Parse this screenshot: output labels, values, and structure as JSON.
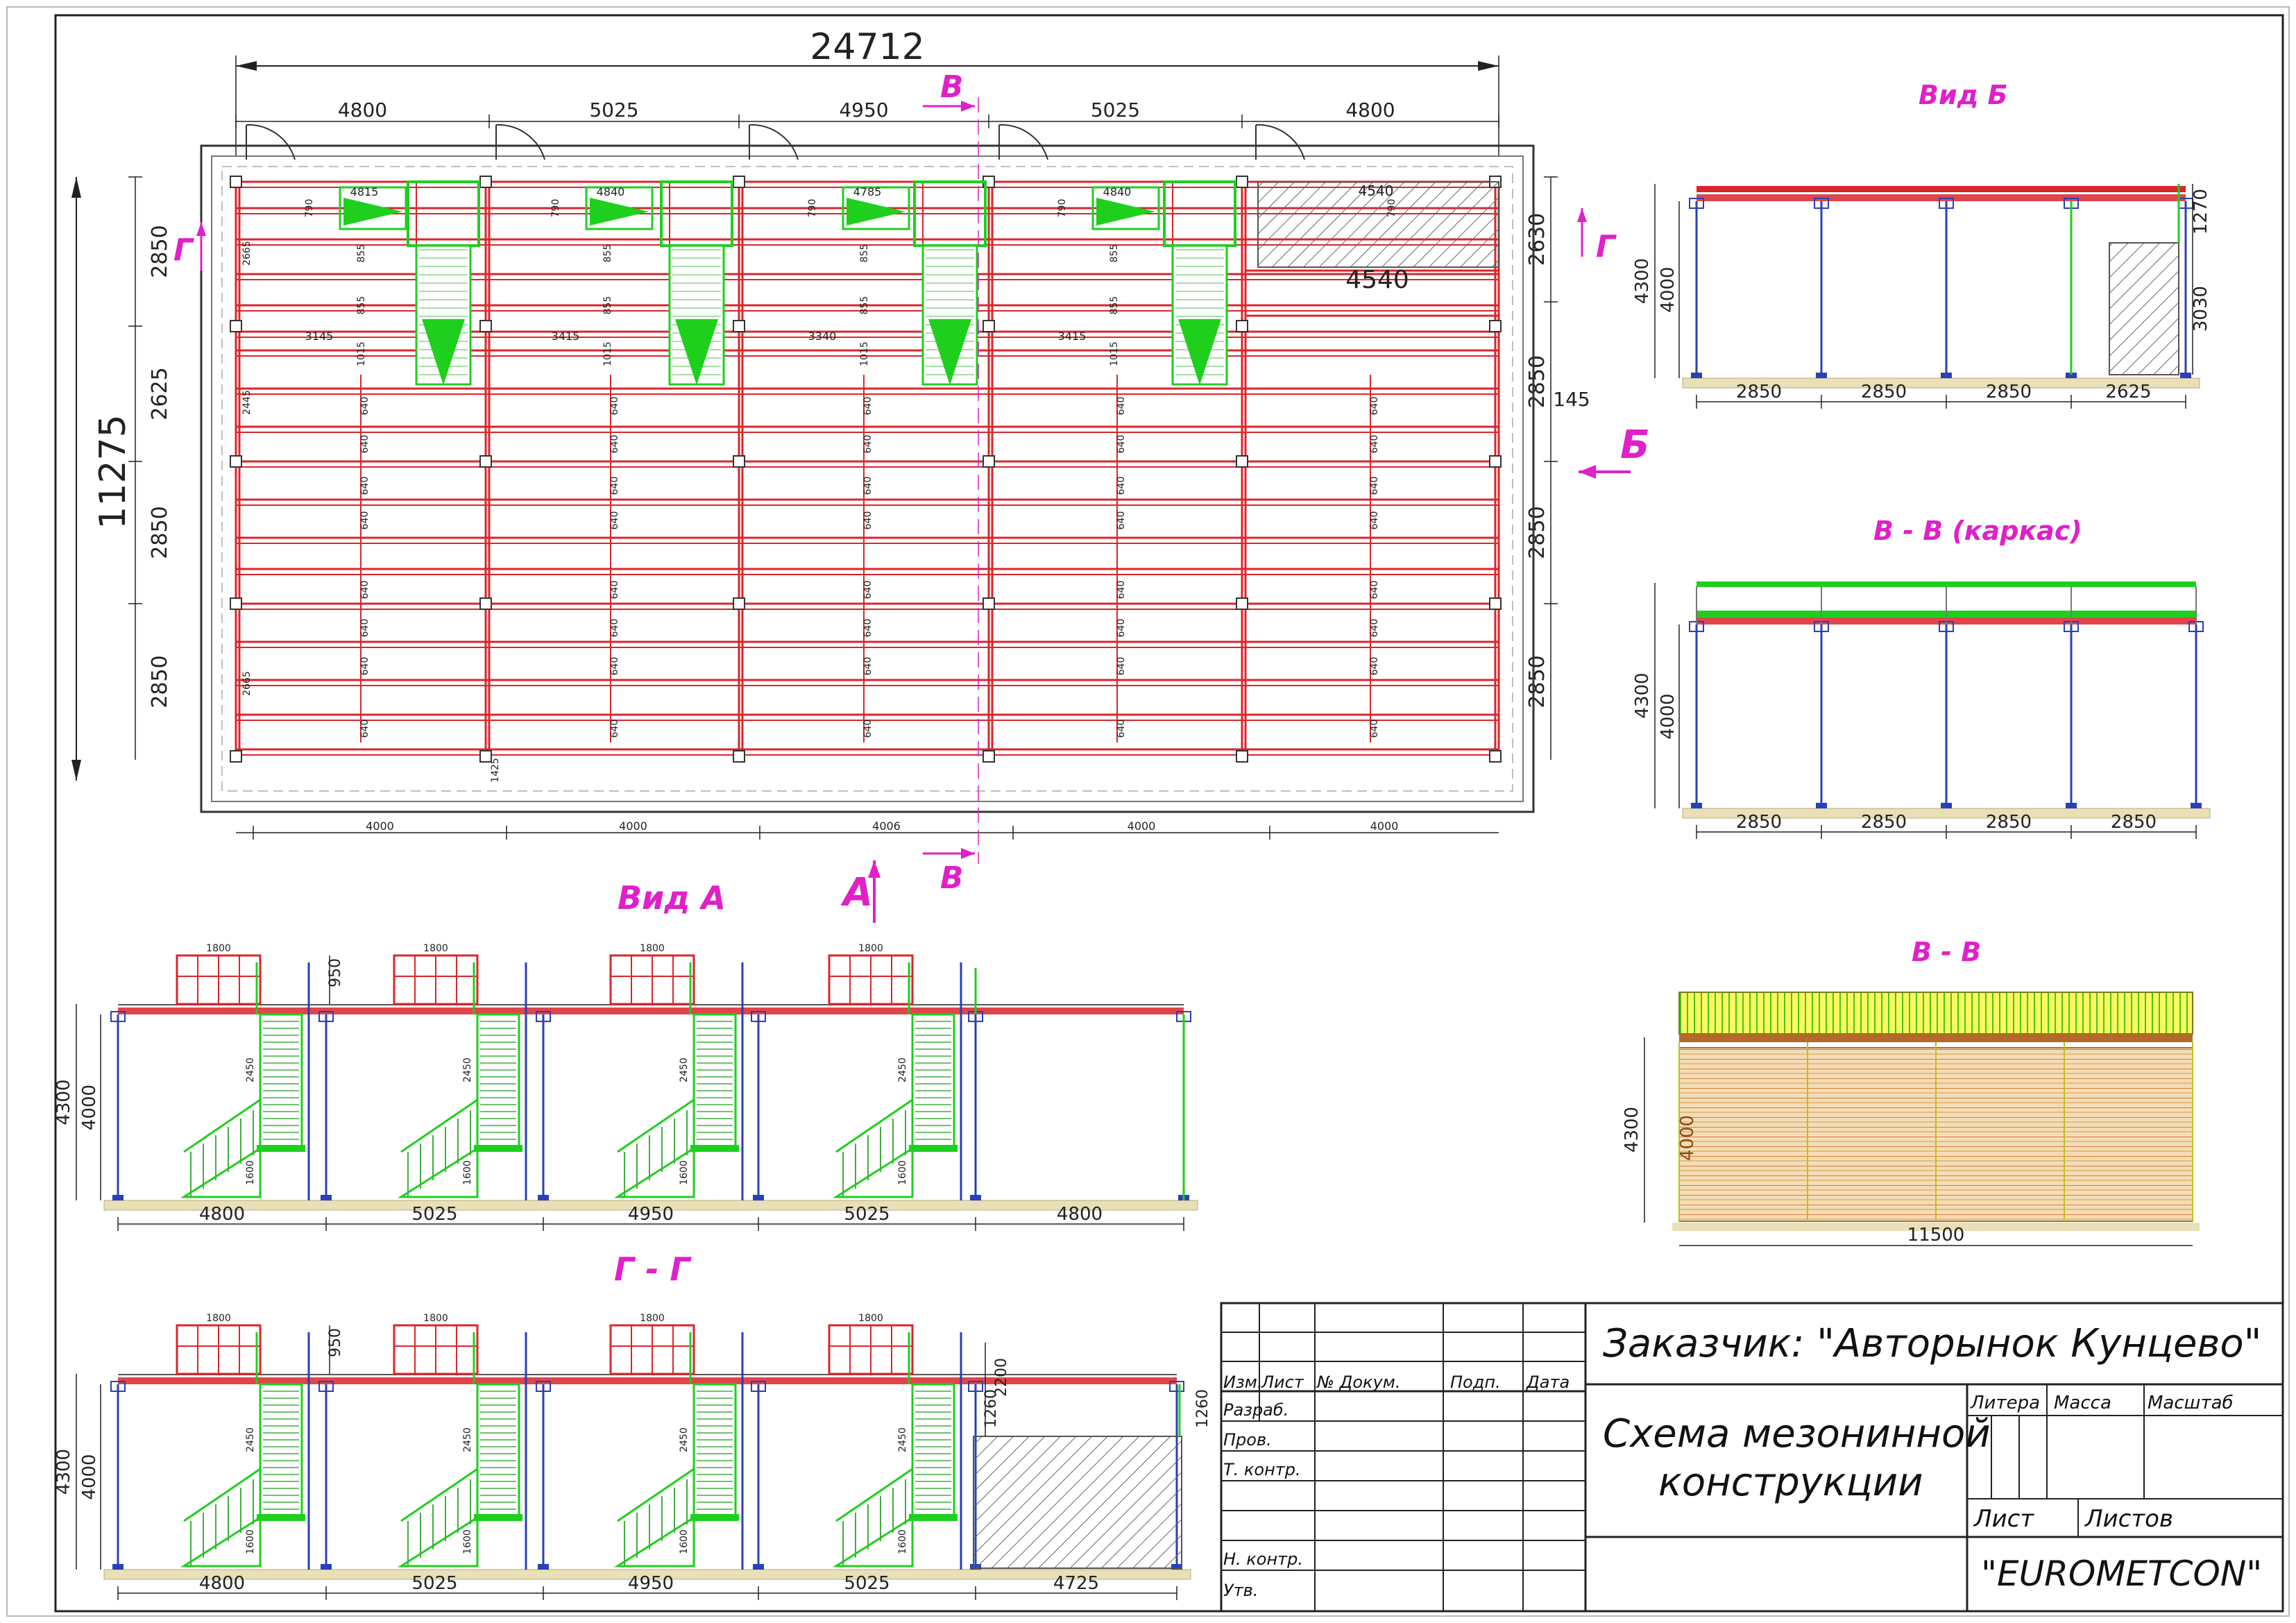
{
  "colors": {
    "beam": "#d9262b",
    "deck": "#1ecf1e",
    "column": "#2a3fb8",
    "dim": "#222222",
    "view_label": "#e020c8",
    "floor": "#e9e0b8",
    "plank": "#e8a85a",
    "rail": "#f2f20a"
  },
  "plan": {
    "overall_width": "24712",
    "top_spans": [
      "4800",
      "5025",
      "4950",
      "5025",
      "4800"
    ],
    "bottom_spans": [
      "4000",
      "4000",
      "4006",
      "4000",
      "4000"
    ],
    "left_total": "11275",
    "left_spans": [
      "2850",
      "2625",
      "2850",
      "2850"
    ],
    "right_spans": [
      "2630",
      "2850",
      "2850",
      "2850"
    ],
    "right_extra": "145",
    "stair_widths": [
      "4815",
      "4840",
      "4785",
      "4840"
    ],
    "bay5_top_width": "4540",
    "bay5_mid_width": "4540",
    "beam_gap_labels": [
      "3145",
      "3415",
      "3340",
      "3415"
    ],
    "small_dim_top": "790",
    "small_dim_mid": "855",
    "small_dim_low": "1015",
    "row_gap": "640",
    "left_small_1": "2665",
    "left_small_2": "2445",
    "left_small_3": "2665",
    "bottom_small": "1425",
    "section_B_top": "В",
    "section_B_bottom": "В",
    "section_G_left": "Г",
    "section_G_right": "Г",
    "arrow_B_label": "Б",
    "arrow_A_label": "А"
  },
  "views": {
    "vid_b": {
      "title": "Вид Б",
      "spans": [
        "2850",
        "2850",
        "2850",
        "2625"
      ],
      "height_total": "4300",
      "height_col": "4000",
      "right_top": "1270",
      "right_bottom": "3030"
    },
    "vv_karkas": {
      "title": "В - В (каркас)",
      "spans": [
        "2850",
        "2850",
        "2850",
        "2850"
      ],
      "height_total": "4300",
      "height_col": "4000"
    },
    "vv": {
      "title": "В - В",
      "width": "11500",
      "height_total": "4300",
      "height_col": "4000"
    },
    "vid_a": {
      "title": "Вид А",
      "spans": [
        "4800",
        "5025",
        "4950",
        "5025",
        "4800"
      ],
      "height_total": "4300",
      "height_col": "4000",
      "rail_height": "950",
      "stair_top": "2450",
      "stair_low": "1600",
      "landing_width": "1800"
    },
    "gg": {
      "title": "Г - Г",
      "spans": [
        "4800",
        "5025",
        "4950",
        "5025",
        "4725"
      ],
      "height_total": "4300",
      "height_col": "4000",
      "rail_height": "950",
      "stair_top": "2450",
      "stair_low": "1600",
      "landing_width": "1800",
      "right_dim_a": "1260",
      "right_dim_b": "2200",
      "right_dim_c": "1260"
    }
  },
  "title_block": {
    "customer": "Заказчик: \"Авторынок Кунцево\"",
    "drawing_title_1": "Схема мезонинной",
    "drawing_title_2": "конструкции",
    "company": "\"EUROMETCON\"",
    "col_izm": "Изм.",
    "col_list": "Лист",
    "col_doc": "№ Докум.",
    "col_sign": "Подп.",
    "col_date": "Дата",
    "row_razrab": "Разраб.",
    "row_prov": "Пров.",
    "row_tkontr": "Т. контр.",
    "row_nkontr": "Н. контр.",
    "row_utv": "Утв.",
    "litera": "Литера",
    "massa": "Масса",
    "masshtab": "Масштаб",
    "list_label": "Лист",
    "listov_label": "Листов"
  }
}
